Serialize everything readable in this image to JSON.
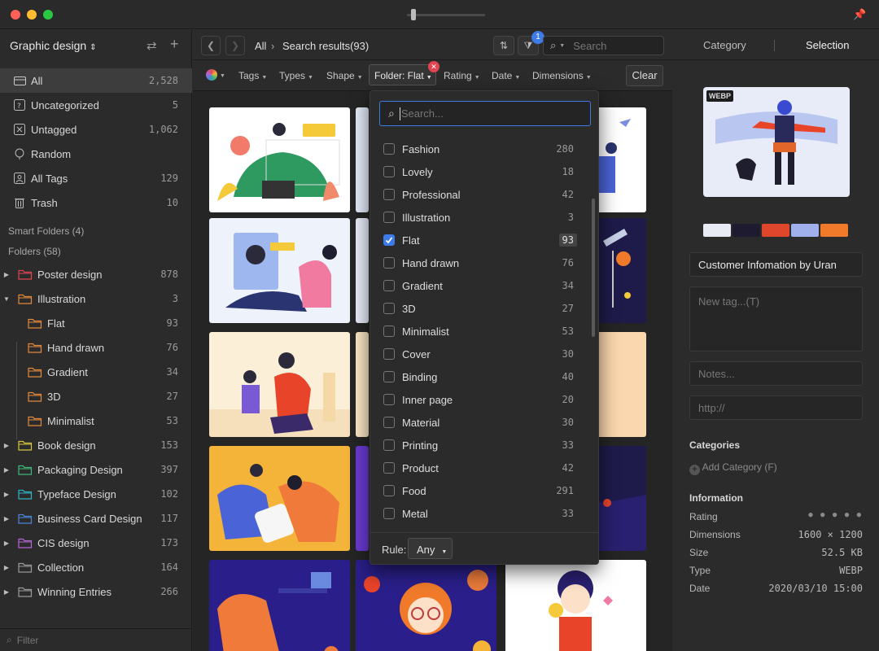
{
  "sidebar": {
    "library_title": "Graphic design",
    "items": [
      {
        "label": "All",
        "count": "2,528",
        "icon": "all-items-icon"
      },
      {
        "label": "Uncategorized",
        "count": "5",
        "icon": "uncategorized-icon"
      },
      {
        "label": "Untagged",
        "count": "1,062",
        "icon": "untagged-icon"
      },
      {
        "label": "Random",
        "count": "",
        "icon": "random-icon"
      },
      {
        "label": "All Tags",
        "count": "129",
        "icon": "all-tags-icon"
      },
      {
        "label": "Trash",
        "count": "10",
        "icon": "trash-icon"
      }
    ],
    "smart_folders_label": "Smart Folders (4)",
    "folders_label": "Folders (58)",
    "folders": [
      {
        "label": "Poster design",
        "count": "878",
        "color": "#e04552",
        "arrow": "▶"
      },
      {
        "label": "Illustration",
        "count": "3",
        "color": "#e0893c",
        "arrow": "▼"
      },
      {
        "label": "Flat",
        "count": "93",
        "color": "#e0893c",
        "arrow": ""
      },
      {
        "label": "Hand drawn",
        "count": "76",
        "color": "#e0893c",
        "arrow": ""
      },
      {
        "label": "Gradient",
        "count": "34",
        "color": "#e0893c",
        "arrow": ""
      },
      {
        "label": "3D",
        "count": "27",
        "color": "#e0893c",
        "arrow": ""
      },
      {
        "label": "Minimalist",
        "count": "53",
        "color": "#e0893c",
        "arrow": ""
      },
      {
        "label": "Book design",
        "count": "153",
        "color": "#d6c53c",
        "arrow": "▶"
      },
      {
        "label": "Packaging Design",
        "count": "397",
        "color": "#3cb878",
        "arrow": "▶"
      },
      {
        "label": "Typeface Design",
        "count": "102",
        "color": "#2fb3c4",
        "arrow": "▶"
      },
      {
        "label": "Business Card Design",
        "count": "117",
        "color": "#4a86d8",
        "arrow": "▶"
      },
      {
        "label": "CIS design",
        "count": "173",
        "color": "#b564d4",
        "arrow": "▶"
      },
      {
        "label": "Collection",
        "count": "164",
        "color": "#9a9a9a",
        "arrow": "▶"
      },
      {
        "label": "Winning Entries",
        "count": "266",
        "color": "#9a9a9a",
        "arrow": "▶"
      }
    ],
    "filter_placeholder": "Filter"
  },
  "toolbar": {
    "crumb_root": "All",
    "crumb_current": "Search results(93)",
    "filter_badge": "1",
    "search_placeholder": "Search"
  },
  "filterbar": {
    "items": [
      "Tags",
      "Types",
      "Shape"
    ],
    "active": "Folder: Flat",
    "items_right": [
      "Rating",
      "Date",
      "Dimensions"
    ],
    "clear_label": "Clear"
  },
  "dropdown": {
    "search_placeholder": "Search...",
    "options": [
      {
        "name": "Fashion",
        "count": "280",
        "checked": false
      },
      {
        "name": "Lovely",
        "count": "18",
        "checked": false
      },
      {
        "name": "Professional",
        "count": "42",
        "checked": false
      },
      {
        "name": "Illustration",
        "count": "3",
        "checked": false
      },
      {
        "name": "Flat",
        "count": "93",
        "checked": true
      },
      {
        "name": "Hand drawn",
        "count": "76",
        "checked": false
      },
      {
        "name": "Gradient",
        "count": "34",
        "checked": false
      },
      {
        "name": "3D",
        "count": "27",
        "checked": false
      },
      {
        "name": "Minimalist",
        "count": "53",
        "checked": false
      },
      {
        "name": "Cover",
        "count": "30",
        "checked": false
      },
      {
        "name": "Binding",
        "count": "40",
        "checked": false
      },
      {
        "name": "Inner page",
        "count": "20",
        "checked": false
      },
      {
        "name": "Material",
        "count": "30",
        "checked": false
      },
      {
        "name": "Printing",
        "count": "33",
        "checked": false
      },
      {
        "name": "Product",
        "count": "42",
        "checked": false
      },
      {
        "name": "Food",
        "count": "291",
        "checked": false
      },
      {
        "name": "Metal",
        "count": "33",
        "checked": false
      }
    ],
    "rule_label": "Rule:",
    "rule_value": "Any"
  },
  "inspector": {
    "tab_category": "Category",
    "tab_selection": "Selection",
    "preview_badge": "WEBP",
    "swatches": [
      "#e8ebf4",
      "#1e1b30",
      "#e0462c",
      "#9fb0ec",
      "#f07a2a"
    ],
    "name_value": "Customer Infomation by Uran",
    "tag_placeholder": "New tag...(T)",
    "notes_placeholder": "Notes...",
    "url_placeholder": "http://",
    "categories_heading": "Categories",
    "add_category_label": "Add Category (F)",
    "info_heading": "Information",
    "info": [
      {
        "key": "Rating",
        "value": "● ● ● ● ●"
      },
      {
        "key": "Dimensions",
        "value": "1600 × 1200"
      },
      {
        "key": "Size",
        "value": "52.5 KB"
      },
      {
        "key": "Type",
        "value": "WEBP"
      },
      {
        "key": "Date",
        "value": "2020/03/10 15:00"
      }
    ]
  }
}
